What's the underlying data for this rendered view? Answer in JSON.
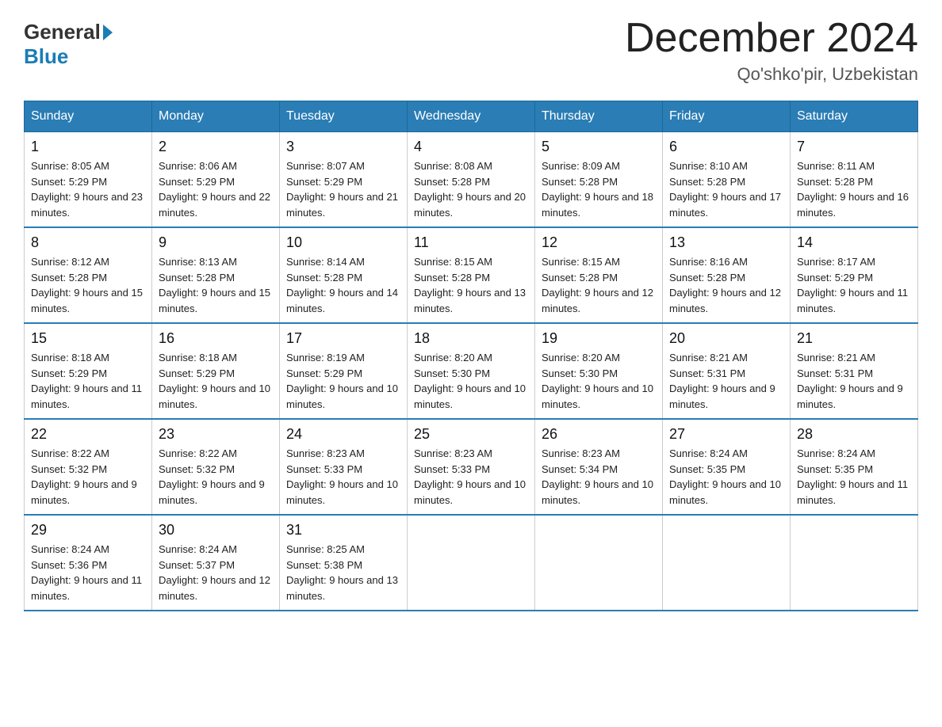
{
  "header": {
    "logo_general": "General",
    "logo_blue": "Blue",
    "month_title": "December 2024",
    "location": "Qo'shko'pir, Uzbekistan"
  },
  "weekdays": [
    "Sunday",
    "Monday",
    "Tuesday",
    "Wednesday",
    "Thursday",
    "Friday",
    "Saturday"
  ],
  "weeks": [
    [
      {
        "day": "1",
        "sunrise": "8:05 AM",
        "sunset": "5:29 PM",
        "daylight": "9 hours and 23 minutes."
      },
      {
        "day": "2",
        "sunrise": "8:06 AM",
        "sunset": "5:29 PM",
        "daylight": "9 hours and 22 minutes."
      },
      {
        "day": "3",
        "sunrise": "8:07 AM",
        "sunset": "5:29 PM",
        "daylight": "9 hours and 21 minutes."
      },
      {
        "day": "4",
        "sunrise": "8:08 AM",
        "sunset": "5:28 PM",
        "daylight": "9 hours and 20 minutes."
      },
      {
        "day": "5",
        "sunrise": "8:09 AM",
        "sunset": "5:28 PM",
        "daylight": "9 hours and 18 minutes."
      },
      {
        "day": "6",
        "sunrise": "8:10 AM",
        "sunset": "5:28 PM",
        "daylight": "9 hours and 17 minutes."
      },
      {
        "day": "7",
        "sunrise": "8:11 AM",
        "sunset": "5:28 PM",
        "daylight": "9 hours and 16 minutes."
      }
    ],
    [
      {
        "day": "8",
        "sunrise": "8:12 AM",
        "sunset": "5:28 PM",
        "daylight": "9 hours and 15 minutes."
      },
      {
        "day": "9",
        "sunrise": "8:13 AM",
        "sunset": "5:28 PM",
        "daylight": "9 hours and 15 minutes."
      },
      {
        "day": "10",
        "sunrise": "8:14 AM",
        "sunset": "5:28 PM",
        "daylight": "9 hours and 14 minutes."
      },
      {
        "day": "11",
        "sunrise": "8:15 AM",
        "sunset": "5:28 PM",
        "daylight": "9 hours and 13 minutes."
      },
      {
        "day": "12",
        "sunrise": "8:15 AM",
        "sunset": "5:28 PM",
        "daylight": "9 hours and 12 minutes."
      },
      {
        "day": "13",
        "sunrise": "8:16 AM",
        "sunset": "5:28 PM",
        "daylight": "9 hours and 12 minutes."
      },
      {
        "day": "14",
        "sunrise": "8:17 AM",
        "sunset": "5:29 PM",
        "daylight": "9 hours and 11 minutes."
      }
    ],
    [
      {
        "day": "15",
        "sunrise": "8:18 AM",
        "sunset": "5:29 PM",
        "daylight": "9 hours and 11 minutes."
      },
      {
        "day": "16",
        "sunrise": "8:18 AM",
        "sunset": "5:29 PM",
        "daylight": "9 hours and 10 minutes."
      },
      {
        "day": "17",
        "sunrise": "8:19 AM",
        "sunset": "5:29 PM",
        "daylight": "9 hours and 10 minutes."
      },
      {
        "day": "18",
        "sunrise": "8:20 AM",
        "sunset": "5:30 PM",
        "daylight": "9 hours and 10 minutes."
      },
      {
        "day": "19",
        "sunrise": "8:20 AM",
        "sunset": "5:30 PM",
        "daylight": "9 hours and 10 minutes."
      },
      {
        "day": "20",
        "sunrise": "8:21 AM",
        "sunset": "5:31 PM",
        "daylight": "9 hours and 9 minutes."
      },
      {
        "day": "21",
        "sunrise": "8:21 AM",
        "sunset": "5:31 PM",
        "daylight": "9 hours and 9 minutes."
      }
    ],
    [
      {
        "day": "22",
        "sunrise": "8:22 AM",
        "sunset": "5:32 PM",
        "daylight": "9 hours and 9 minutes."
      },
      {
        "day": "23",
        "sunrise": "8:22 AM",
        "sunset": "5:32 PM",
        "daylight": "9 hours and 9 minutes."
      },
      {
        "day": "24",
        "sunrise": "8:23 AM",
        "sunset": "5:33 PM",
        "daylight": "9 hours and 10 minutes."
      },
      {
        "day": "25",
        "sunrise": "8:23 AM",
        "sunset": "5:33 PM",
        "daylight": "9 hours and 10 minutes."
      },
      {
        "day": "26",
        "sunrise": "8:23 AM",
        "sunset": "5:34 PM",
        "daylight": "9 hours and 10 minutes."
      },
      {
        "day": "27",
        "sunrise": "8:24 AM",
        "sunset": "5:35 PM",
        "daylight": "9 hours and 10 minutes."
      },
      {
        "day": "28",
        "sunrise": "8:24 AM",
        "sunset": "5:35 PM",
        "daylight": "9 hours and 11 minutes."
      }
    ],
    [
      {
        "day": "29",
        "sunrise": "8:24 AM",
        "sunset": "5:36 PM",
        "daylight": "9 hours and 11 minutes."
      },
      {
        "day": "30",
        "sunrise": "8:24 AM",
        "sunset": "5:37 PM",
        "daylight": "9 hours and 12 minutes."
      },
      {
        "day": "31",
        "sunrise": "8:25 AM",
        "sunset": "5:38 PM",
        "daylight": "9 hours and 13 minutes."
      },
      {
        "day": "",
        "sunrise": "",
        "sunset": "",
        "daylight": ""
      },
      {
        "day": "",
        "sunrise": "",
        "sunset": "",
        "daylight": ""
      },
      {
        "day": "",
        "sunrise": "",
        "sunset": "",
        "daylight": ""
      },
      {
        "day": "",
        "sunrise": "",
        "sunset": "",
        "daylight": ""
      }
    ]
  ]
}
